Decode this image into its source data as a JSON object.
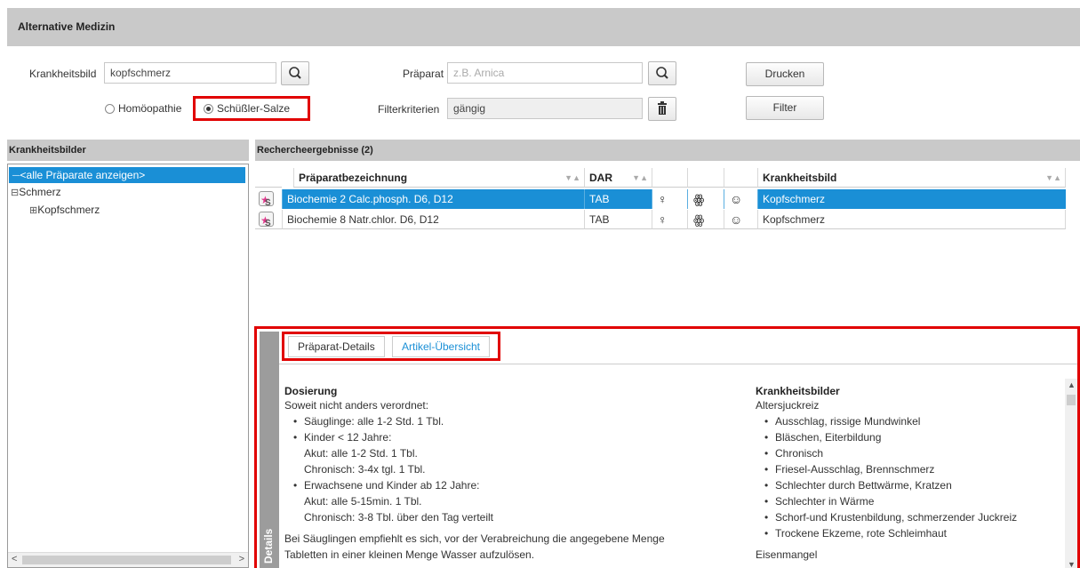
{
  "app": {
    "title": "Alternative Medizin"
  },
  "search": {
    "krankheitsbild_label": "Krankheitsbild",
    "krankheitsbild_value": "kopfschmerz",
    "praeparat_label": "Präparat",
    "praeparat_placeholder": "z.B. Arnica",
    "filterkriterien_label": "Filterkriterien",
    "filterkriterien_value": "gängig",
    "radio_homoeopathie": "Homöopathie",
    "radio_schuessler": "Schüßler-Salze",
    "selected_radio": "Schüßler-Salze",
    "print_button": "Drucken",
    "filter_button": "Filter"
  },
  "tree": {
    "header": "Krankheitsbilder",
    "items": [
      {
        "label": "<alle Präparate anzeigen>",
        "selected": true
      },
      {
        "label": "Schmerz",
        "expander": "⊟"
      },
      {
        "label": "Kopfschmerz",
        "expander": "⊞"
      }
    ]
  },
  "results": {
    "header": "Rechercheergebnisse (2)",
    "columns": {
      "name": "Präparatbezeichnung",
      "dar": "DAR",
      "krankheitsbild": "Krankheitsbild"
    },
    "rows": [
      {
        "name": "Biochemie 2 Calc.phosph. D6, D12",
        "dar": "TAB",
        "krankheitsbild": "Kopfschmerz"
      },
      {
        "name": "Biochemie 8 Natr.chlor. D6, D12",
        "dar": "TAB",
        "krankheitsbild": "Kopfschmerz"
      }
    ]
  },
  "details": {
    "side_tab": "Details",
    "tabs": [
      "Präparat-Details",
      "Artikel-Übersicht"
    ],
    "active_tab": "Artikel-Übersicht",
    "dosierung": {
      "title": "Dosierung",
      "intro": "Soweit nicht anders verordnet:",
      "b1": "Säuglinge: alle 1-2 Std. 1 Tbl.",
      "b2": "Kinder < 12 Jahre:",
      "b2a": "Akut: alle 1-2 Std. 1 Tbl.",
      "b2b": "Chronisch: 3-4x tgl. 1 Tbl.",
      "b3": "Erwachsene und Kinder ab 12 Jahre:",
      "b3a": "Akut: alle 5-15min. 1 Tbl.",
      "b3b": "Chronisch: 3-8 Tbl. über den Tag verteilt",
      "note1": "Bei Säuglingen empfiehlt es sich, vor der Verabreichung die angegebene Menge",
      "note2": "Tabletten in einer kleinen Menge Wasser aufzulösen."
    },
    "krankheitsbilder": {
      "title": "Krankheitsbilder",
      "group1": "Altersjuckreiz",
      "items": [
        "Ausschlag, rissige Mundwinkel",
        "Bläschen, Eiterbildung",
        "Chronisch",
        "Friesel-Ausschlag, Brennschmerz",
        "Schlechter durch Bettwärme, Kratzen",
        "Schlechter in Wärme",
        "Schorf-und Krustenbildung, schmerzender Juckreiz",
        "Trockene Ekzeme, rote Schleimhaut"
      ],
      "group2": "Eisenmangel"
    }
  }
}
